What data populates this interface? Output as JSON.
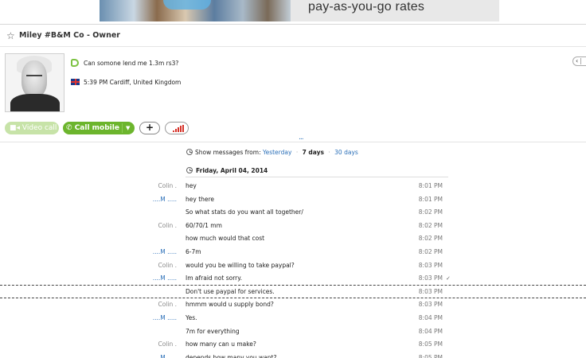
{
  "ad": {
    "text": "pay-as-you-go rates"
  },
  "header": {
    "favorite_icon": "star-outline-icon",
    "title": "Miley #B&M Co - Owner"
  },
  "profile": {
    "mood": "Can somone lend me 1.3m rs3?",
    "location": "5:39 PM Cardiff, United Kingdom",
    "flag_icon": "uk-flag-icon"
  },
  "side_tab": {
    "label": "‹"
  },
  "actions": {
    "video_call": "Video call",
    "call_mobile": "Call mobile",
    "add": "+",
    "more": "..."
  },
  "history": {
    "prefix": "Show messages from:",
    "options": [
      "Yesterday",
      "7 days",
      "30 days"
    ],
    "selected": "7 days",
    "date": "Friday, April 04, 2014"
  },
  "colors": {
    "accent": "#6cb52d",
    "link": "#2a6fb8",
    "signal": "#d6332a"
  },
  "messages": [
    {
      "sender": "Colin .",
      "text": "hey",
      "time": "8:01 PM"
    },
    {
      "sender": "....M .....",
      "text": "hey there",
      "time": "8:01 PM"
    },
    {
      "sender": "",
      "text": "So what stats do you want all together/",
      "time": "8:02 PM"
    },
    {
      "sender": "Colin .",
      "text": "60/70/1 mm",
      "time": "8:02 PM"
    },
    {
      "sender": "",
      "text": "how much would that cost",
      "time": "8:02 PM"
    },
    {
      "sender": "....M .....",
      "text": "6-7m",
      "time": "8:02 PM"
    },
    {
      "sender": "Colin .",
      "text": "would you be willing to take paypal?",
      "time": "8:03 PM"
    },
    {
      "sender": "....M .....",
      "text": "Im afraid not sorry.",
      "time": "8:03 PM",
      "extra": "✓"
    },
    {
      "sender": "",
      "text": "Don't use paypal for services.",
      "time": "8:03 PM"
    },
    {
      "sender": "Colin .",
      "text": "hmmm would u supply bond?",
      "time": "8:03 PM"
    },
    {
      "sender": "....M .....",
      "text": "Yes.",
      "time": "8:04 PM"
    },
    {
      "sender": "",
      "text": "7m for everything",
      "time": "8:04 PM"
    },
    {
      "sender": "Colin .",
      "text": "how many can u make?",
      "time": "8:05 PM"
    },
    {
      "sender": "....M .....",
      "text": "depends how many you want?",
      "time": "8:05 PM"
    }
  ]
}
